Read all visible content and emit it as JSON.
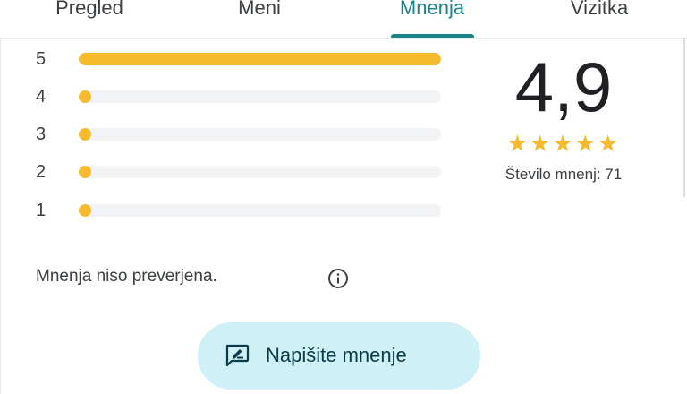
{
  "tabs": [
    {
      "label": "Pregled",
      "active": false
    },
    {
      "label": "Meni",
      "active": false
    },
    {
      "label": "Mnenja",
      "active": true
    },
    {
      "label": "Vizitka",
      "active": false
    }
  ],
  "rating_summary": {
    "score": "4,9",
    "stars": "★★★★★",
    "count_text": "Število mnenj: 71"
  },
  "distribution": [
    {
      "label": "5",
      "fraction": 1.0
    },
    {
      "label": "4",
      "fraction": 0.035
    },
    {
      "label": "3",
      "fraction": 0.02
    },
    {
      "label": "2",
      "fraction": 0.006
    },
    {
      "label": "1",
      "fraction": 0.02
    }
  ],
  "verification_note": "Mnenja niso preverjena.",
  "write_review": {
    "label": "Napišite mnenje",
    "icon": "write-review-icon"
  },
  "colors": {
    "accent": "#1a8589",
    "star": "#f6bb2d",
    "button_bg": "#cff0f7"
  },
  "icons": {
    "info": "info-icon",
    "write": "rate-review-icon"
  }
}
